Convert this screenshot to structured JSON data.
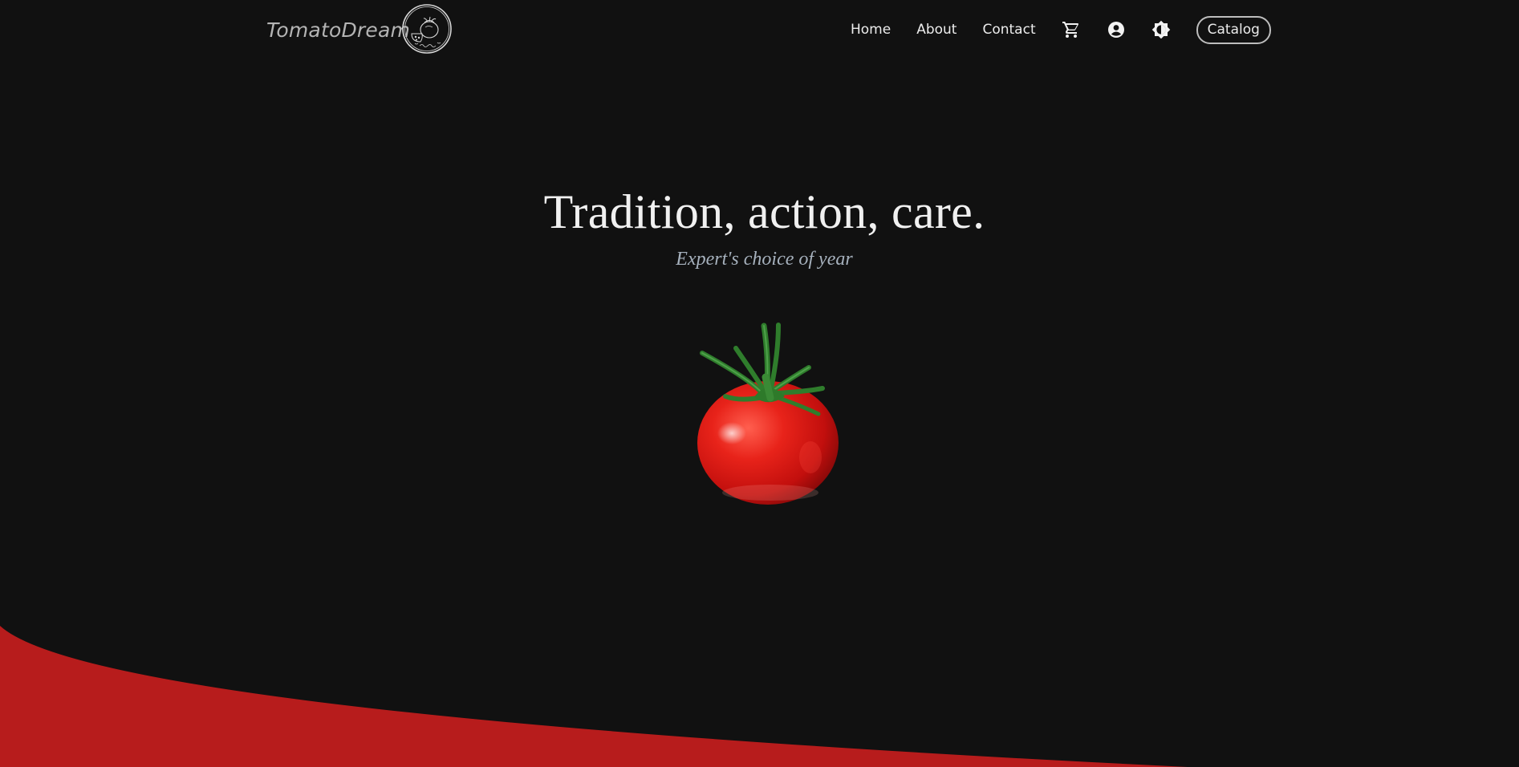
{
  "brand": {
    "name": "TomatoDream",
    "logo_icon": "tomato-logo-icon",
    "logo_caption": "TomatoDream"
  },
  "nav": {
    "links": [
      "Home",
      "About",
      "Contact"
    ],
    "icons": [
      "cart-icon",
      "account-circle-icon",
      "brightness-icon"
    ],
    "catalog_label": "Catalog"
  },
  "hero": {
    "title": "Tradition, action, care.",
    "subtitle": "Expert's choice of year",
    "image": "tomato-image"
  },
  "colors": {
    "background": "#111111",
    "accent_red": "#b71c1c",
    "text": "#eeeeee",
    "subtitle": "#a6b1bd"
  }
}
